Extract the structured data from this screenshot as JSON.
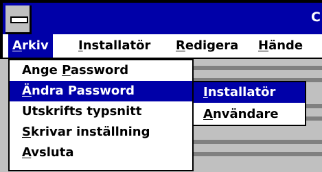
{
  "window": {
    "title_visible": "C",
    "titlebar_color": "#0000a8",
    "menu_highlight_color": "#0000a8"
  },
  "menubar": {
    "items": [
      {
        "label": "Arkiv",
        "accel": "A",
        "rest": "rkiv"
      },
      {
        "label": "Installatör",
        "accel": "I",
        "rest": "nstallatör"
      },
      {
        "label": "Redigera",
        "accel": "R",
        "rest": "edigera"
      },
      {
        "label": "Hände",
        "accel": "H",
        "rest": "ände"
      }
    ]
  },
  "arkiv_menu": {
    "items": [
      {
        "pre": "Ange ",
        "accel": "P",
        "post": "assword"
      },
      {
        "pre": "",
        "accel": "Ä",
        "post": "ndra Password"
      },
      {
        "pre": "Utskrifts typsnitt",
        "accel": "",
        "post": ""
      },
      {
        "pre": "",
        "accel": "S",
        "post": "krivar inställning"
      },
      {
        "pre": "",
        "accel": "A",
        "post": "vsluta"
      }
    ]
  },
  "submenu": {
    "items": [
      {
        "pre": "",
        "accel": "I",
        "post": "nstallatör"
      },
      {
        "pre": "",
        "accel": "A",
        "post": "nvändare"
      }
    ]
  }
}
